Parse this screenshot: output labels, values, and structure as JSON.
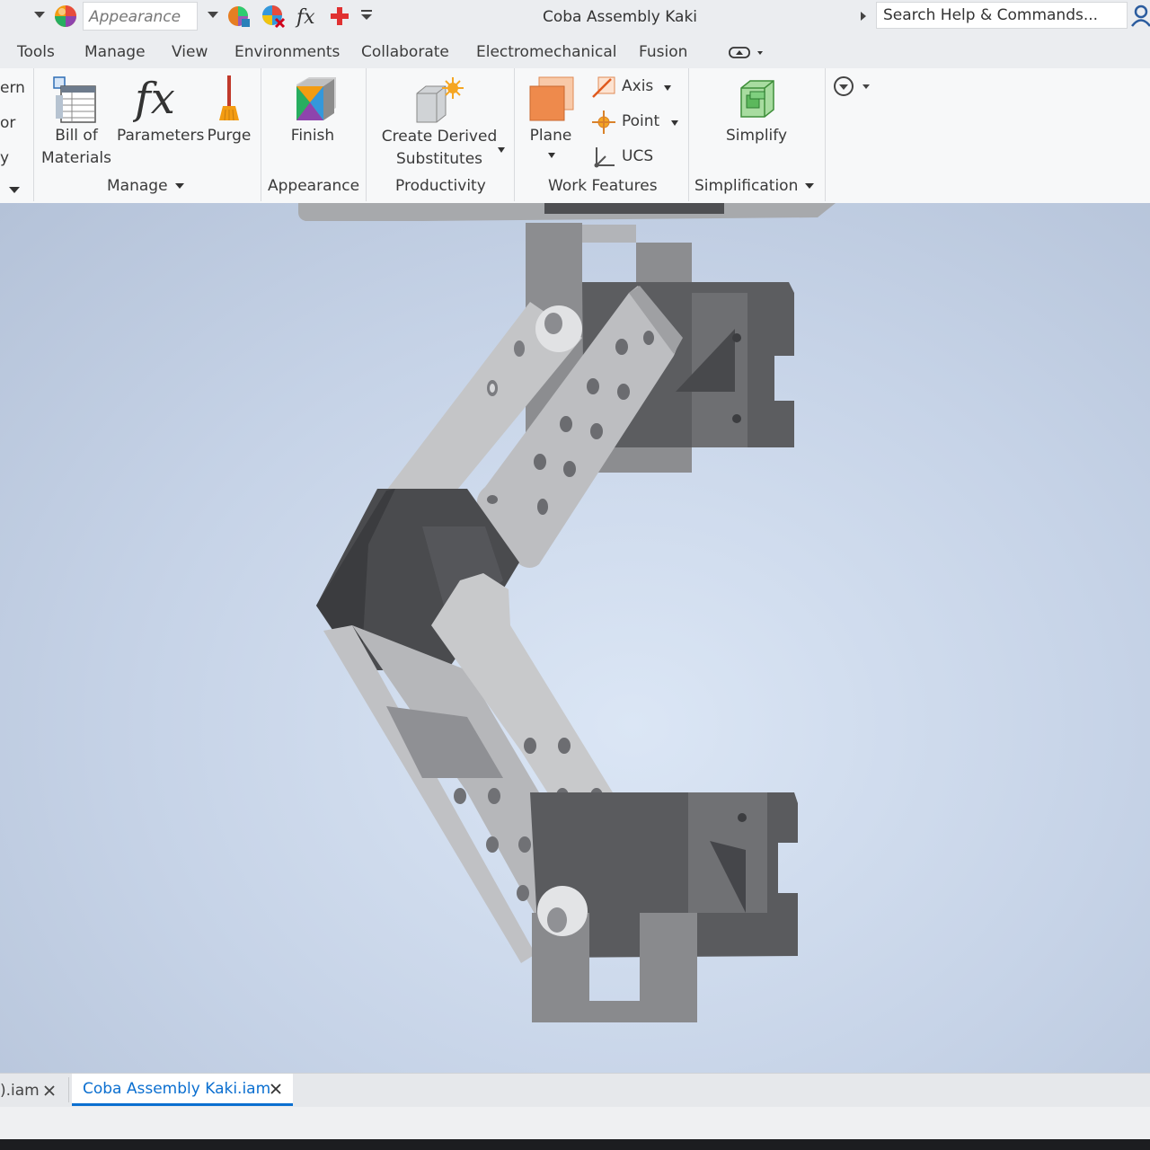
{
  "app": {
    "window_title": "Coba Assembly Kaki"
  },
  "quick_access": {
    "appearance_value": "Appearance",
    "icons": [
      "appearance-sphere-icon",
      "color-override-icon",
      "clear-appearance-icon",
      "fx-icon",
      "add-icon",
      "customize-toolbar-icon"
    ]
  },
  "search": {
    "placeholder": "Search Help & Commands..."
  },
  "menu": {
    "tabs": [
      "Tools",
      "Manage",
      "View",
      "Environments",
      "Collaborate",
      "Electromechanical",
      "Fusion"
    ]
  },
  "ribbon": {
    "clipped_labels": [
      "ern",
      "or",
      "y"
    ],
    "manage": {
      "bill_of_materials_line1": "Bill of",
      "bill_of_materials_line2": "Materials",
      "parameters": "Parameters",
      "purge": "Purge",
      "title": "Manage"
    },
    "appearance": {
      "finish": "Finish",
      "title": "Appearance"
    },
    "productivity": {
      "create_derived_line1": "Create Derived",
      "create_derived_line2": "Substitutes",
      "title": "Productivity"
    },
    "work_features": {
      "plane": "Plane",
      "axis": "Axis",
      "point": "Point",
      "ucs": "UCS",
      "title": "Work Features"
    },
    "simplification": {
      "simplify": "Simplify",
      "title": "Simplification"
    }
  },
  "document_tabs": [
    {
      "label": ").iam",
      "active": false
    },
    {
      "label": "Coba Assembly Kaki.iam",
      "active": true
    }
  ],
  "colors": {
    "accent": "#0b6fd0",
    "viewport_center": "#dbe6f5",
    "viewport_edge": "#b4c2d8"
  }
}
